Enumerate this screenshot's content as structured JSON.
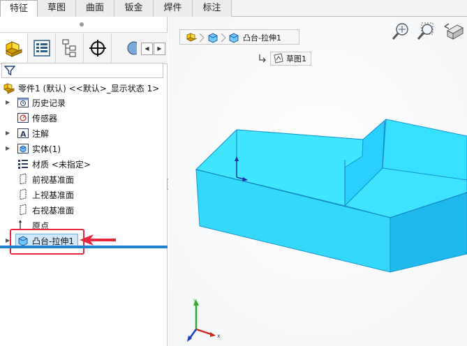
{
  "tabs": [
    {
      "label": "特征",
      "active": true
    },
    {
      "label": "草图",
      "active": false
    },
    {
      "label": "曲面",
      "active": false
    },
    {
      "label": "钣金",
      "active": false
    },
    {
      "label": "焊件",
      "active": false
    },
    {
      "label": "标注",
      "active": false
    }
  ],
  "tree": {
    "root": "零件1 (默认) <<默认>_显示状态 1>",
    "items": [
      {
        "label": "历史记录",
        "icon": "history-folder-icon"
      },
      {
        "label": "传感器",
        "icon": "sensor-icon"
      },
      {
        "label": "注解",
        "icon": "annotation-icon"
      },
      {
        "label": "实体(1)",
        "icon": "solid-bodies-icon"
      },
      {
        "label": "材质 <未指定>",
        "icon": "material-icon"
      },
      {
        "label": "前视基准面",
        "icon": "plane-icon"
      },
      {
        "label": "上视基准面",
        "icon": "plane-icon"
      },
      {
        "label": "右视基准面",
        "icon": "plane-icon"
      },
      {
        "label": "原点",
        "icon": "origin-icon"
      },
      {
        "label": "凸台-拉伸1",
        "icon": "boss-extrude-icon"
      }
    ]
  },
  "breadcrumb": {
    "feature": "凸台-拉伸1",
    "sketch": "草图1"
  },
  "triad": {
    "x": "x"
  },
  "colors": {
    "model": "#33e3ff",
    "model_dark": "#1a9fd6",
    "highlight": "#e6283f",
    "selection": "#1e7fd0"
  }
}
